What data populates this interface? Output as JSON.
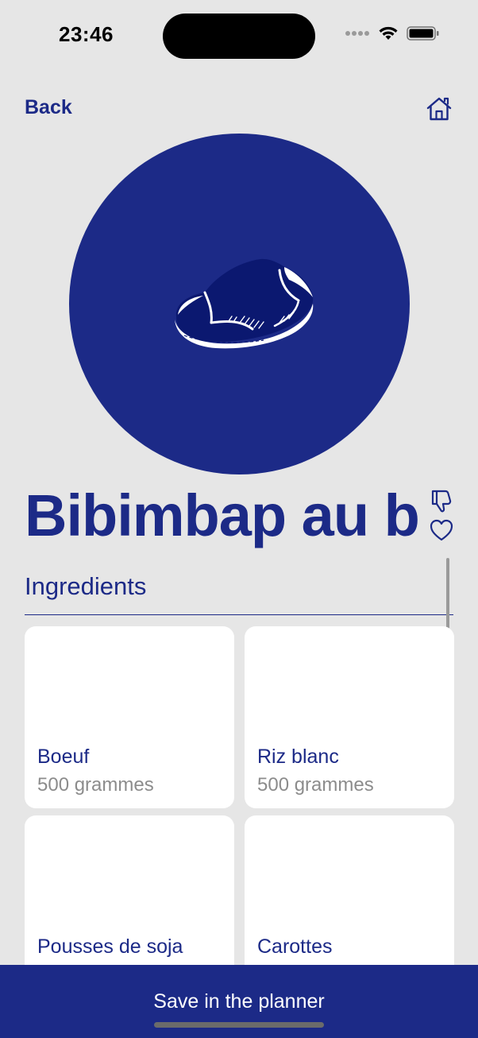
{
  "status_bar": {
    "time": "23:46"
  },
  "nav": {
    "back_label": "Back",
    "home_icon": "house-icon"
  },
  "hero": {
    "icon": "steak-icon"
  },
  "recipe": {
    "title": "Bibimbap au boeuf"
  },
  "ingredients": {
    "section_title": "Ingredients",
    "items": [
      {
        "name": "Boeuf",
        "quantity": "500 grammes"
      },
      {
        "name": "Riz blanc",
        "quantity": "500 grammes"
      },
      {
        "name": "Pousses de soja",
        "quantity": ""
      },
      {
        "name": "Carottes",
        "quantity": ""
      }
    ]
  },
  "footer": {
    "save_label": "Save in the planner"
  },
  "colors": {
    "accent": "#1c2a87",
    "background": "#e6e6e6",
    "card": "#ffffff",
    "muted_text": "#8c8c8c"
  }
}
